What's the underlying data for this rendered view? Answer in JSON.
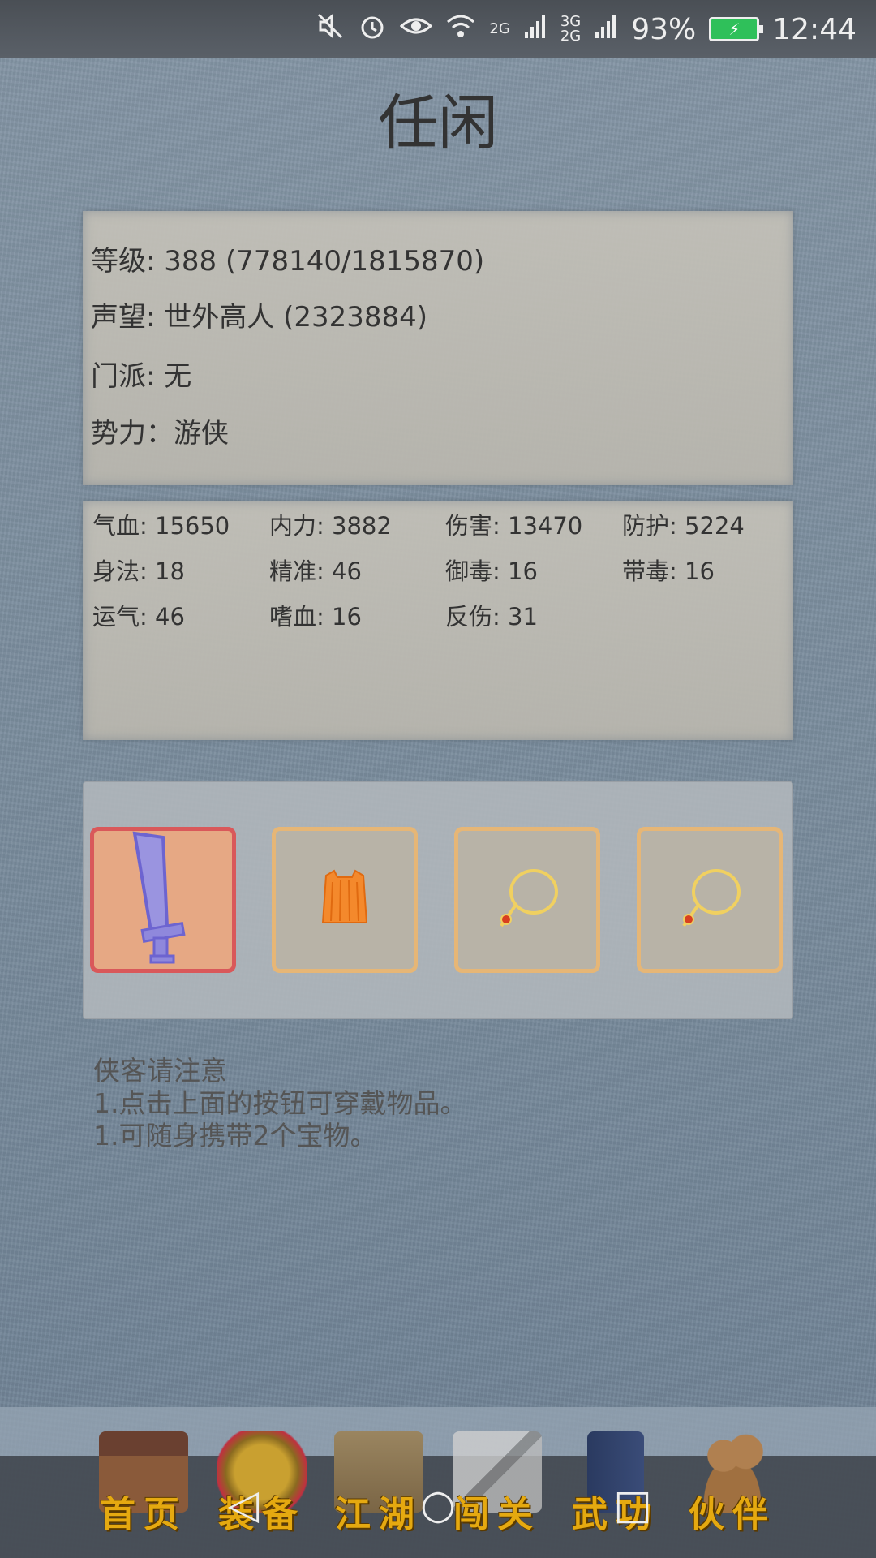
{
  "status_bar": {
    "signal_1": "2G",
    "signal_2_top": "3G",
    "signal_2_bottom": "2G",
    "battery": "93%",
    "time": "12:44"
  },
  "title": "任闲",
  "info": {
    "level": "等级: 388 (778140/1815870)",
    "fame": "声望: 世外高人 (2323884)",
    "sect": "门派: 无",
    "faction": "势力：游侠"
  },
  "stats": [
    [
      "气血: 15650",
      "内力: 3882",
      "伤害: 13470",
      "防护: 5224"
    ],
    [
      "身法: 18",
      "精准: 46",
      "御毒: 16",
      "带毒: 16"
    ],
    [
      "运气: 46",
      "嗜血: 16",
      "反伤: 31"
    ]
  ],
  "equipment": {
    "slots": [
      {
        "icon": "sword-icon"
      },
      {
        "icon": "armor-icon"
      },
      {
        "icon": "necklace-icon"
      },
      {
        "icon": "necklace-icon"
      }
    ],
    "colors": {
      "weapon_border": "#d9585a",
      "slot_border": "#e6b676"
    }
  },
  "notice": {
    "heading": "侠客请注意",
    "line1": "1.点击上面的按钮可穿戴物品。",
    "line2": "1.可随身携带2个宝物。"
  },
  "nav": {
    "home": "首页",
    "equip": "装备",
    "jianghu": "江湖",
    "challenge": "闯关",
    "martial": "武功",
    "partner": "伙伴"
  },
  "system_nav": {
    "back": "◁",
    "home": "○",
    "recents": "□"
  }
}
